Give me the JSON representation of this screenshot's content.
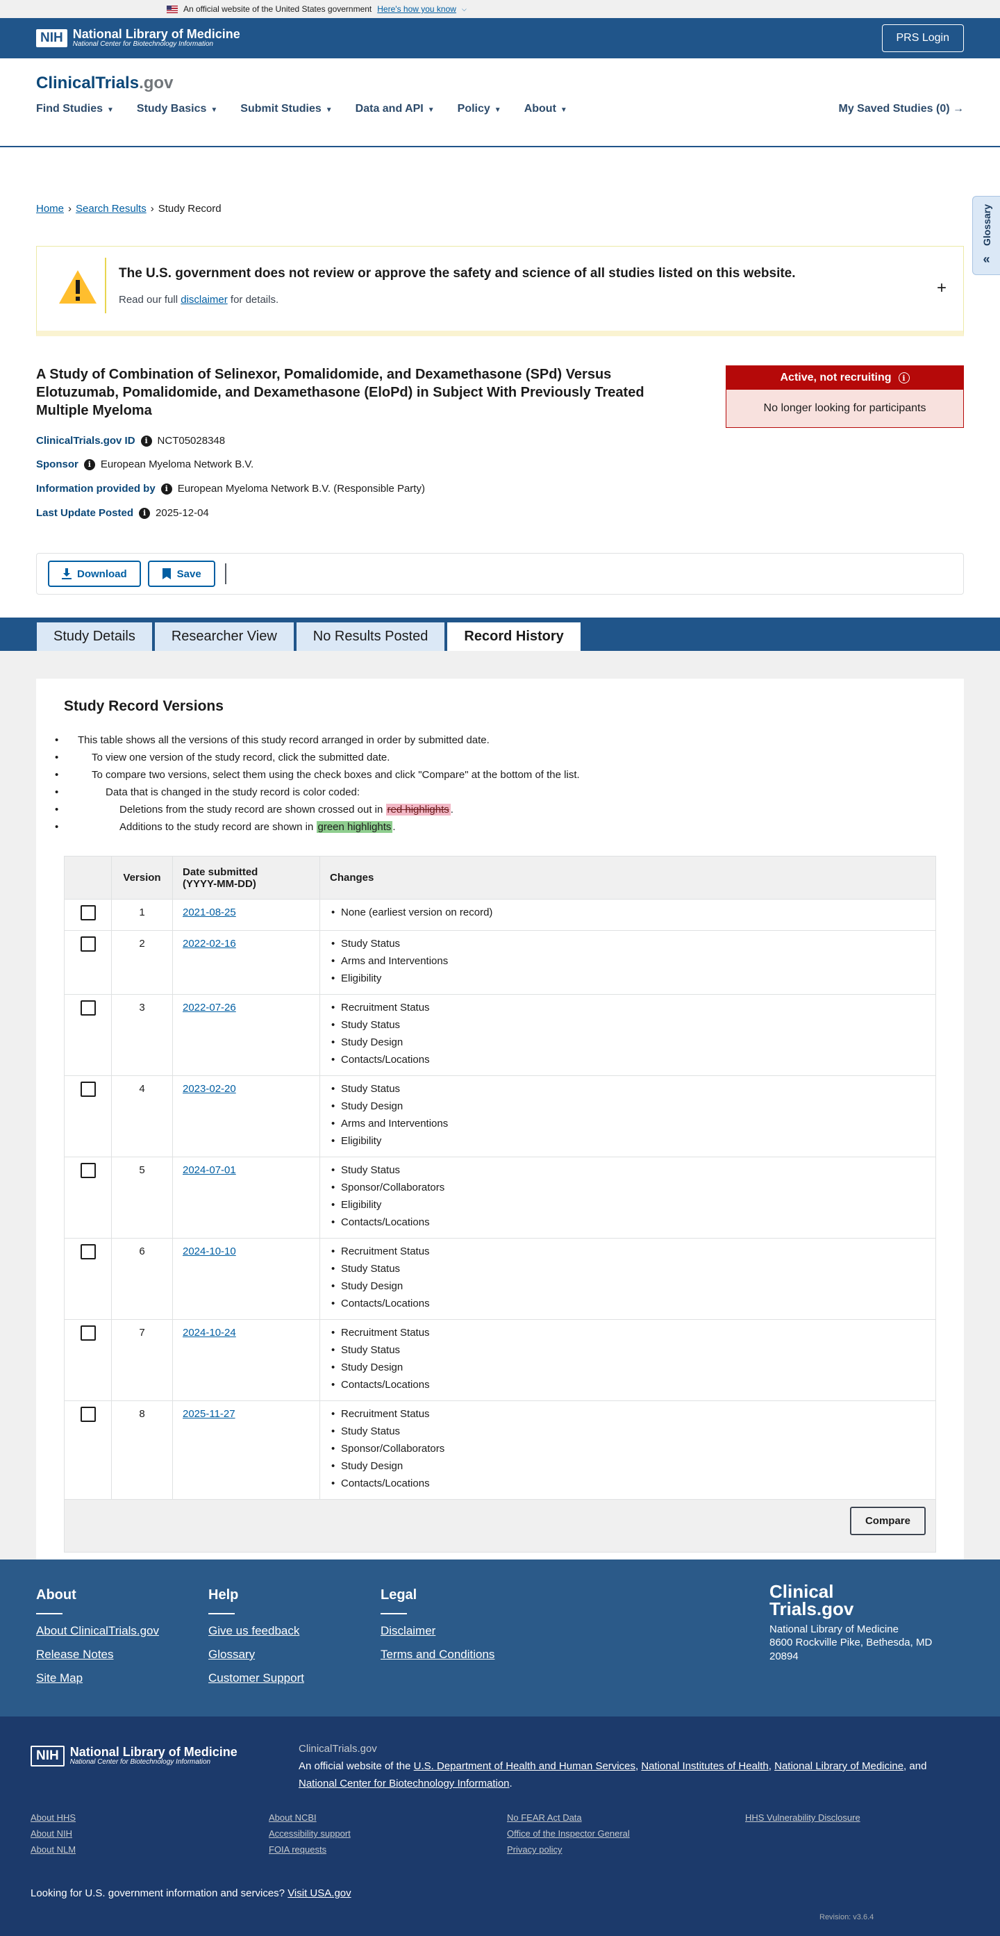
{
  "gov_banner": {
    "text": "An official website of the United States government",
    "link": "Here's how you know"
  },
  "nih_header": {
    "logo_mark": "NIH",
    "name": "National Library of Medicine",
    "subtitle": "National Center for Biotechnology Information",
    "prs_login": "PRS Login"
  },
  "site": {
    "logo_main": "ClinicalTrials",
    "logo_suffix": ".gov"
  },
  "nav": {
    "items": [
      {
        "label": "Find Studies"
      },
      {
        "label": "Study Basics"
      },
      {
        "label": "Submit Studies"
      },
      {
        "label": "Data and API"
      },
      {
        "label": "Policy"
      },
      {
        "label": "About"
      }
    ],
    "saved": "My Saved Studies (0)"
  },
  "glossary_tab": {
    "label": "Glossary"
  },
  "breadcrumb": {
    "home": "Home",
    "search": "Search Results",
    "current": "Study Record"
  },
  "disclaimer": {
    "title": "The U.S. government does not review or approve the safety and science of all studies listed on this website.",
    "body_prefix": "Read our full",
    "link": "disclaimer",
    "body_suffix": "for details."
  },
  "study": {
    "title": "A Study of Combination of Selinexor, Pomalidomide, and Dexamethasone (SPd) Versus Elotuzumab, Pomalidomide, and Dexamethasone (EloPd) in Subject With Previously Treated Multiple Myeloma",
    "status": "Active, not recruiting",
    "status_detail": "No longer looking for participants",
    "id_label": "ClinicalTrials.gov ID",
    "id_value": "NCT05028348",
    "sponsor_label": "Sponsor",
    "sponsor_value": "European Myeloma Network B.V.",
    "info_label": "Information provided by",
    "info_value": "European Myeloma Network B.V. (Responsible Party)",
    "update_label": "Last Update Posted",
    "update_value": "2025-12-04"
  },
  "actions": {
    "download": "Download",
    "save": "Save"
  },
  "tabs": [
    "Study Details",
    "Researcher View",
    "No Results Posted",
    "Record History"
  ],
  "versions": {
    "title": "Study Record Versions",
    "b1": "This table shows all the versions of this study record arranged in order by submitted date.",
    "b2": "To view one version of the study record, click the submitted date.",
    "b3": "To compare two versions, select them using the check boxes and click \"Compare\" at the bottom of the list.",
    "b4": "Data that is changed in the study record is color coded:",
    "b5_prefix": "Deletions from the study record are shown crossed out in",
    "b5_hl": "red highlights",
    "b6_prefix": "Additions to the study record are shown in",
    "b6_hl": "green highlights",
    "col_version": "Version",
    "col_date_1": "Date submitted",
    "col_date_2": "(YYYY-MM-DD)",
    "col_changes": "Changes",
    "rows": [
      {
        "version": "1",
        "date": "2021-08-25",
        "changes": [
          "None (earliest version on record)"
        ]
      },
      {
        "version": "2",
        "date": "2022-02-16",
        "changes": [
          "Study Status",
          "Arms and Interventions",
          "Eligibility"
        ]
      },
      {
        "version": "3",
        "date": "2022-07-26",
        "changes": [
          "Recruitment Status",
          "Study Status",
          "Study Design",
          "Contacts/Locations"
        ]
      },
      {
        "version": "4",
        "date": "2023-02-20",
        "changes": [
          "Study Status",
          "Study Design",
          "Arms and Interventions",
          "Eligibility"
        ]
      },
      {
        "version": "5",
        "date": "2024-07-01",
        "changes": [
          "Study Status",
          "Sponsor/Collaborators",
          "Eligibility",
          "Contacts/Locations"
        ]
      },
      {
        "version": "6",
        "date": "2024-10-10",
        "changes": [
          "Recruitment Status",
          "Study Status",
          "Study Design",
          "Contacts/Locations"
        ]
      },
      {
        "version": "7",
        "date": "2024-10-24",
        "changes": [
          "Recruitment Status",
          "Study Status",
          "Study Design",
          "Contacts/Locations"
        ]
      },
      {
        "version": "8",
        "date": "2025-11-27",
        "changes": [
          "Recruitment Status",
          "Study Status",
          "Sponsor/Collaborators",
          "Study Design",
          "Contacts/Locations"
        ]
      }
    ],
    "compare": "Compare"
  },
  "footer": {
    "about_h": "About",
    "about_links": [
      "About ClinicalTrials.gov",
      "Release Notes",
      "Site Map"
    ],
    "help_h": "Help",
    "help_links": [
      "Give us feedback",
      "Glossary",
      "Customer Support"
    ],
    "legal_h": "Legal",
    "legal_links": [
      "Disclaimer",
      "Terms and Conditions"
    ],
    "logo_1": "Clinical",
    "logo_2": "Trials.gov",
    "org": "National Library of Medicine",
    "addr1": "8600 Rockville Pike, Bethesda, MD",
    "addr2": "20894"
  },
  "footer2": {
    "site": "ClinicalTrials.gov",
    "official_prefix": "An official website of the",
    "hhs": "U.S. Department of Health and Human Services",
    "nih": "National Institutes of Health",
    "nlm": "National Library of Medicine",
    "and": "and",
    "ncbi": "National Center for Biotechnology Information",
    "links": [
      "About HHS",
      "About NCBI",
      "No FEAR Act Data",
      "HHS Vulnerability Disclosure",
      "About NIH",
      "Accessibility support",
      "Office of the Inspector General",
      "",
      "About NLM",
      "FOIA requests",
      "Privacy policy",
      ""
    ],
    "usa_prefix": "Looking for U.S. government information and services?",
    "usa_link": "Visit USA.gov",
    "revision": "Revision: v3.6.4"
  }
}
